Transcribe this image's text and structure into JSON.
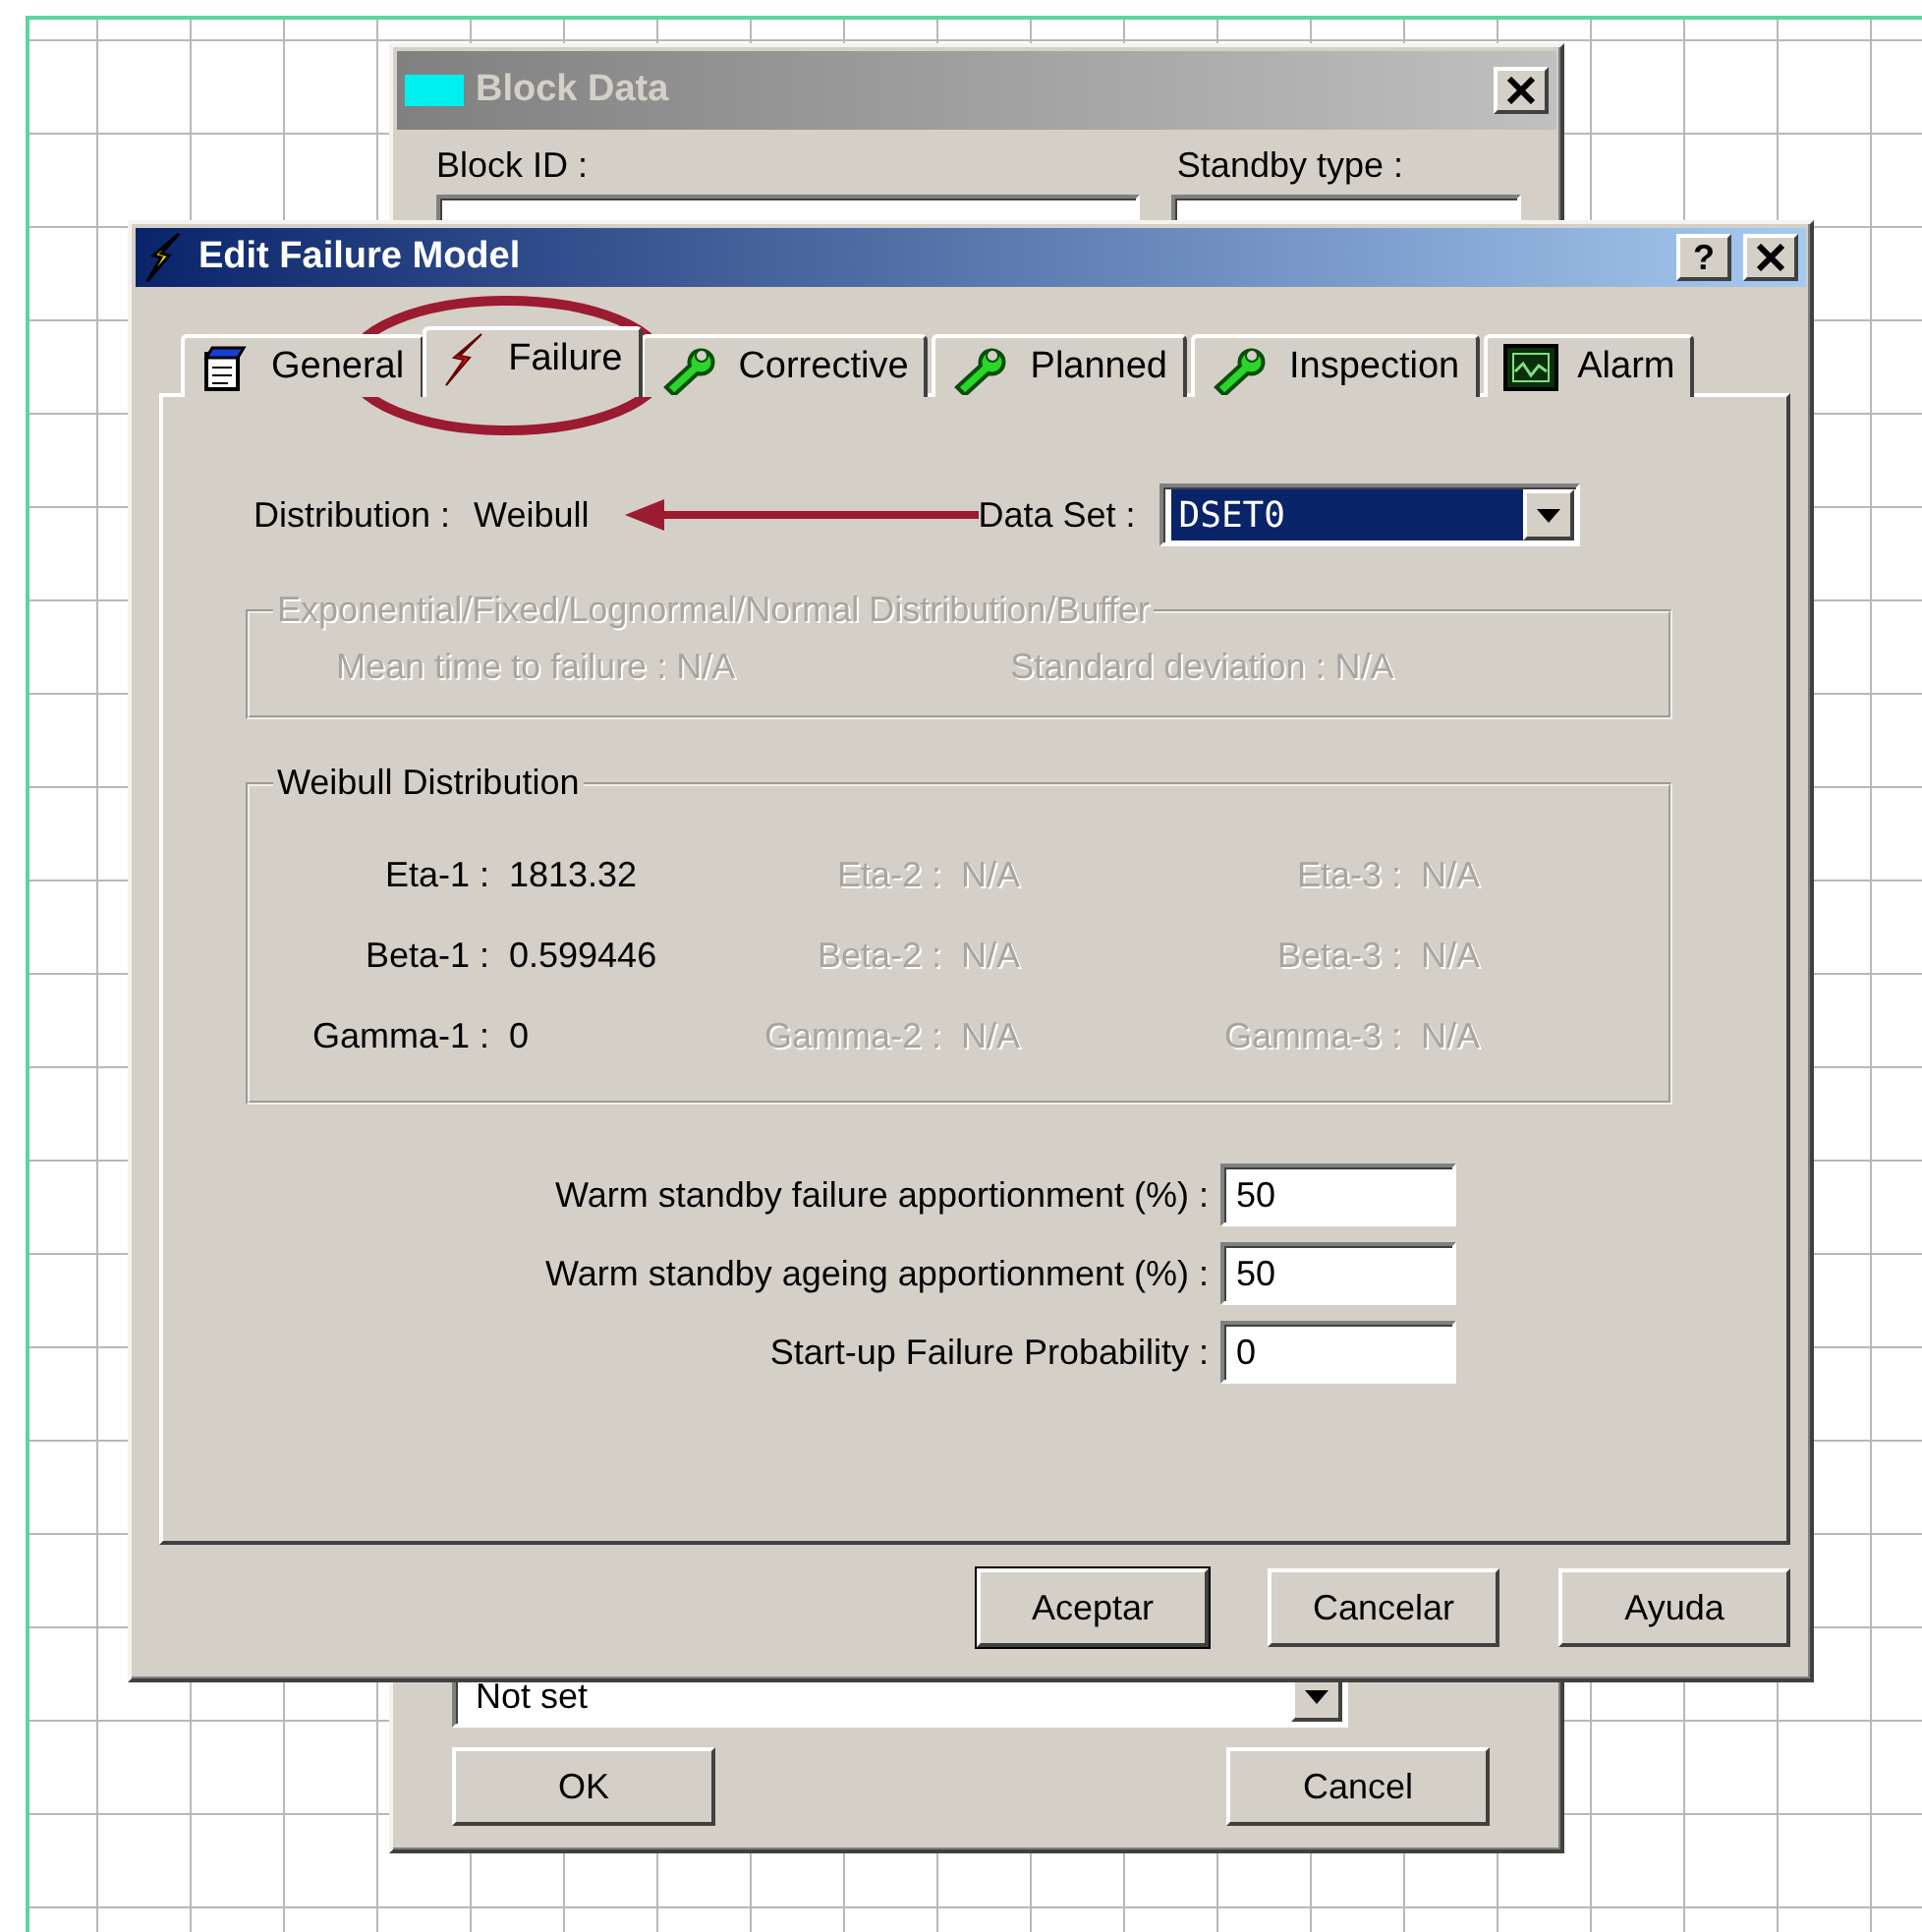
{
  "background_window": {
    "title": "Block Data",
    "block_id_label": "Block ID :",
    "standby_type_label": "Standby type :",
    "combo_value": "Not set",
    "buttons": [
      {
        "label": "OK"
      },
      {
        "label": "Cancel"
      }
    ]
  },
  "dialog": {
    "title": "Edit Failure Model",
    "help_button": "?",
    "tabs": [
      {
        "label": "General",
        "selected": false
      },
      {
        "label": "Failure",
        "selected": true
      },
      {
        "label": "Corrective",
        "selected": false
      },
      {
        "label": "Planned",
        "selected": false
      },
      {
        "label": "Inspection",
        "selected": false
      },
      {
        "label": "Alarm",
        "selected": false
      }
    ],
    "distribution": {
      "label": "Distribution :",
      "value": "Weibull"
    },
    "data_set": {
      "label": "Data Set :",
      "value": "DSET0"
    },
    "exponential_group": {
      "title": "Exponential/Fixed/Lognormal/Normal Distribution/Buffer",
      "disabled": true,
      "fields": [
        {
          "label": "Mean time to failure :",
          "value": "N/A"
        },
        {
          "label": "Standard deviation :",
          "value": "N/A"
        }
      ]
    },
    "weibull_group": {
      "title": "Weibull Distribution",
      "rows": [
        {
          "cells": [
            {
              "label": "Eta-1 :",
              "value": "1813.32",
              "disabled": false
            },
            {
              "label": "Eta-2 :",
              "value": "N/A",
              "disabled": true
            },
            {
              "label": "Eta-3 :",
              "value": "N/A",
              "disabled": true
            }
          ]
        },
        {
          "cells": [
            {
              "label": "Beta-1 :",
              "value": "0.599446",
              "disabled": false
            },
            {
              "label": "Beta-2 :",
              "value": "N/A",
              "disabled": true
            },
            {
              "label": "Beta-3 :",
              "value": "N/A",
              "disabled": true
            }
          ]
        },
        {
          "cells": [
            {
              "label": "Gamma-1 :",
              "value": "0",
              "disabled": false
            },
            {
              "label": "Gamma-2 :",
              "value": "N/A",
              "disabled": true
            },
            {
              "label": "Gamma-3 :",
              "value": "N/A",
              "disabled": true
            }
          ]
        }
      ]
    },
    "inputs": [
      {
        "label": "Warm standby failure apportionment (%) :",
        "value": "50"
      },
      {
        "label": "Warm standby ageing apportionment (%) :",
        "value": "50"
      },
      {
        "label": "Start-up Failure Probability :",
        "value": "0"
      }
    ],
    "buttons": [
      {
        "label": "Aceptar",
        "default": true
      },
      {
        "label": "Cancelar",
        "default": false
      },
      {
        "label": "Ayuda",
        "default": false
      }
    ]
  }
}
